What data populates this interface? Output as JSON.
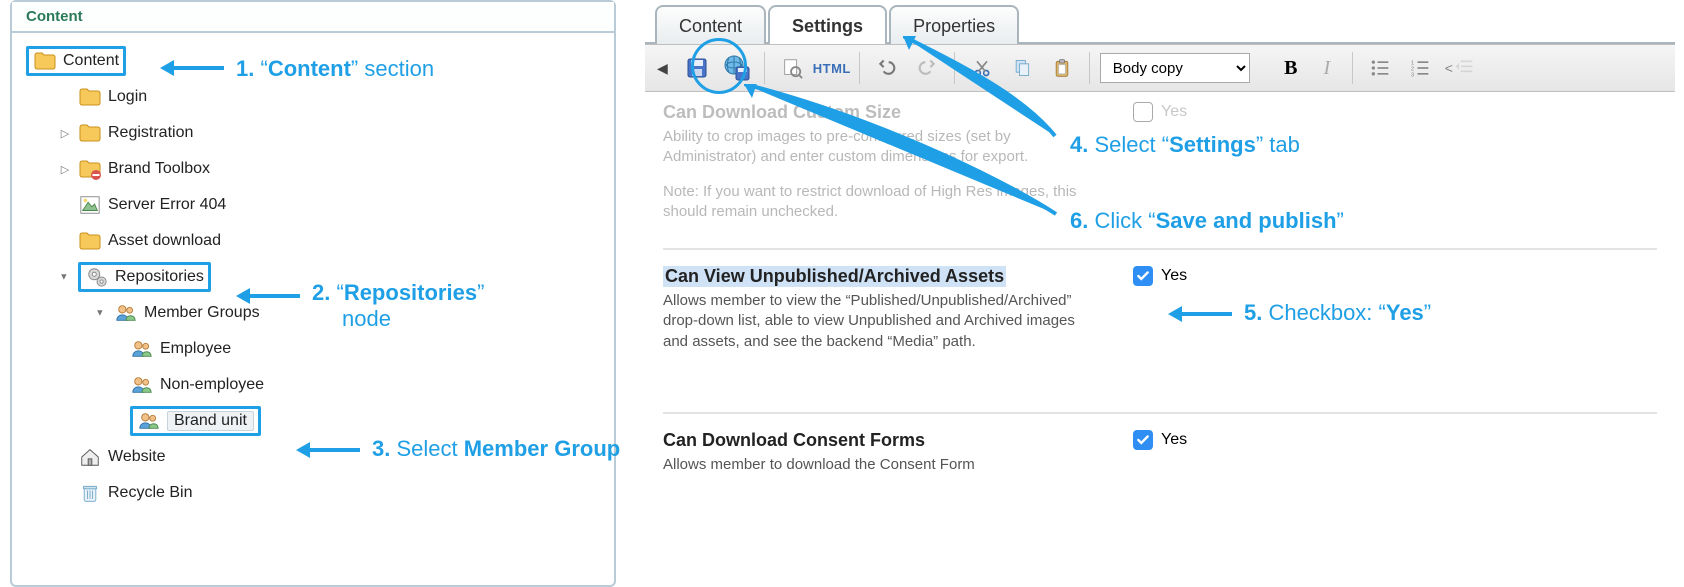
{
  "panel": {
    "title": "Content"
  },
  "tree": {
    "content": "Content",
    "login": "Login",
    "registration": "Registration",
    "brand_toolbox": "Brand Toolbox",
    "server_error": "Server Error 404",
    "asset_download": "Asset download",
    "repositories": "Repositories",
    "member_groups": "Member Groups",
    "employee": "Employee",
    "non_employee": "Non-employee",
    "brand_unit": "Brand unit",
    "website": "Website",
    "recycle_bin": "Recycle Bin"
  },
  "tabs": {
    "content": "Content",
    "settings": "Settings",
    "properties": "Properties"
  },
  "toolbar": {
    "style_value": "Body copy",
    "html": "HTML"
  },
  "settings": {
    "custom_size": {
      "title": "Can Download Custom Size",
      "desc": "Ability to crop images to pre-configured sizes (set by Administrator) and enter custom dimensions for export.",
      "note": "Note: If you want to restrict download of High Res images, this should remain unchecked.",
      "yes": "Yes"
    },
    "unpublished": {
      "title": "Can View Unpublished/Archived Assets",
      "desc": "Allows member to view the “Published/Unpublished/Archived” drop-down list, able to view Unpublished and Archived images and assets, and see the backend “Media” path.",
      "yes": "Yes"
    },
    "consent": {
      "title": "Can Download Consent Forms",
      "desc": "Allows member to download the Consent Form",
      "yes": "Yes"
    }
  },
  "anno": {
    "a1_pre": "1.",
    "a1_q1": " “",
    "a1_b": "Content",
    "a1_suf": "” section",
    "a2_pre": "2.",
    "a2_q1": " “",
    "a2_b": "Repositories",
    "a2_suf": "”",
    "a2_line2": "node",
    "a3_pre": "3.",
    "a3_mid": " Select ",
    "a3_b": "Member Group",
    "a4_pre": "4.",
    "a4_mid": " Select “",
    "a4_b": "Settings",
    "a4_suf": "” tab",
    "a5_pre": "5.",
    "a5_mid": " Checkbox: “",
    "a5_b": "Yes",
    "a5_suf": "”",
    "a6_pre": "6.",
    "a6_mid": " Click “",
    "a6_b": "Save and publish",
    "a6_suf": "”"
  }
}
